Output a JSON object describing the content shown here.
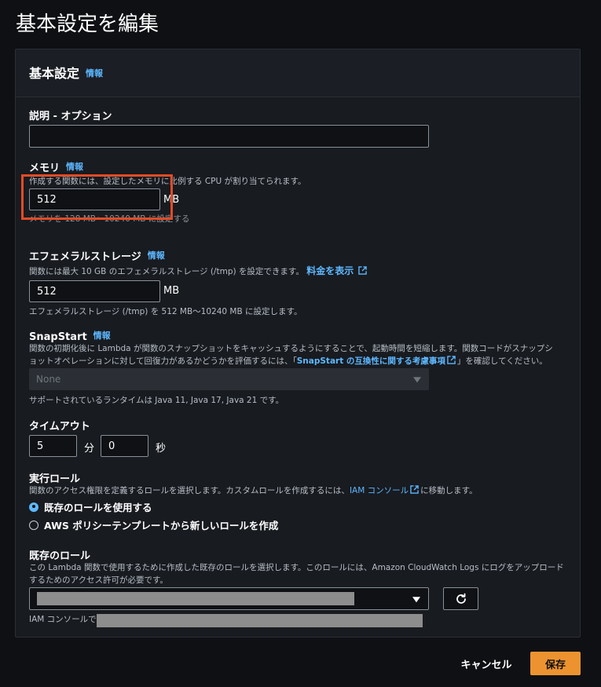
{
  "page": {
    "title": "基本設定を編集"
  },
  "panel": {
    "title": "基本設定",
    "info": "情報"
  },
  "description_field": {
    "label": "説明 - オプション",
    "value": ""
  },
  "memory": {
    "label": "メモリ",
    "info": "情報",
    "desc": "作成する関数には、設定したメモリに比例する CPU が割り当てられます。",
    "value": "512",
    "unit": "MB",
    "hint": "メモリを 128 MB～10240 MB に設定する"
  },
  "ephemeral": {
    "label": "エフェメラルストレージ",
    "info": "情報",
    "desc": "関数には最大 10 GB のエフェメラルストレージ (/tmp) を設定できます。",
    "pricing_link": "料金を表示",
    "value": "512",
    "unit": "MB",
    "hint": "エフェメラルストレージ (/tmp) を 512 MB～10240 MB に設定します。"
  },
  "snapstart": {
    "label": "SnapStart",
    "info": "情報",
    "desc_line1": "関数の初期化後に Lambda が関数のスナップショットをキャッシュするようにすることで、起動時間を短縮します。関数コードがスナップシ",
    "desc_line2_prefix": "ョットオペレーションに対して回復力があるかどうかを評価するには、「",
    "desc_link": "SnapStart の互換性に関する考慮事項",
    "desc_line2_suffix": "」を確認してください。",
    "selected": "None",
    "runtimes": "サポートされているランタイムは Java 11, Java 17, Java 21 です。"
  },
  "timeout": {
    "label": "タイムアウト",
    "minutes": "5",
    "minutes_unit": "分",
    "seconds": "0",
    "seconds_unit": "秒"
  },
  "exec_role": {
    "label": "実行ロール",
    "desc_prefix": "関数のアクセス権限を定義するロールを選択します。カスタムロールを作成するには、",
    "desc_link": "IAM コンソール",
    "desc_suffix": "に移動します。",
    "options": [
      {
        "label": "既存のロールを使用する",
        "checked": true
      },
      {
        "label": "AWS ポリシーテンプレートから新しいロールを作成",
        "checked": false
      }
    ]
  },
  "existing_role": {
    "label": "既存のロール",
    "desc_line1": "この Lambda 関数で使用するために作成した既存のロールを選択します。このロールには、Amazon CloudWatch Logs にログをアップロード",
    "desc_line2": "するためのアクセス許可が必要です。",
    "footer_prefix": "IAM コンソールで"
  },
  "actions": {
    "cancel": "キャンセル",
    "save": "保存"
  },
  "colors": {
    "accent_link": "#5db8ff",
    "primary_button": "#ec9330",
    "highlight": "#e24b26"
  }
}
